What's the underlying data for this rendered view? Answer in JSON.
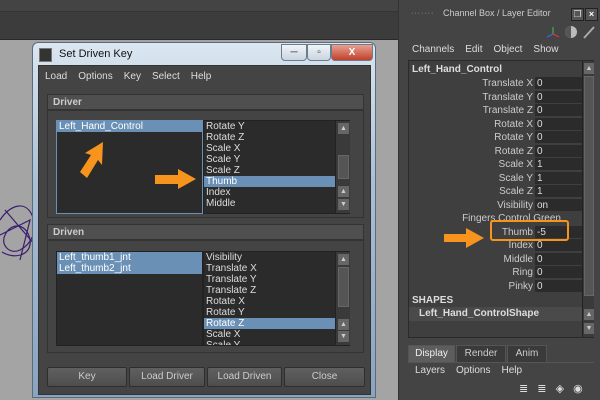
{
  "dialog": {
    "title": "Set Driven Key",
    "window_buttons": {
      "minimize": "─",
      "maximize": "▫",
      "close": "X"
    },
    "menu": [
      "Load",
      "Options",
      "Key",
      "Select",
      "Help"
    ],
    "driver": {
      "header": "Driver",
      "objects": [
        {
          "label": "Left_Hand_Control",
          "selected": true
        }
      ],
      "attributes": [
        {
          "label": "Rotate Y",
          "selected": false
        },
        {
          "label": "Rotate Z",
          "selected": false
        },
        {
          "label": "Scale X",
          "selected": false
        },
        {
          "label": "Scale Y",
          "selected": false
        },
        {
          "label": "Scale Z",
          "selected": false
        },
        {
          "label": "Thumb",
          "selected": true
        },
        {
          "label": "Index",
          "selected": false
        },
        {
          "label": "Middle",
          "selected": false
        }
      ]
    },
    "driven": {
      "header": "Driven",
      "objects": [
        {
          "label": "Left_thumb1_jnt",
          "selected": true
        },
        {
          "label": "Left_thumb2_jnt",
          "selected": true
        }
      ],
      "attributes": [
        {
          "label": "Visibility",
          "selected": false
        },
        {
          "label": "Translate X",
          "selected": false
        },
        {
          "label": "Translate Y",
          "selected": false
        },
        {
          "label": "Translate Z",
          "selected": false
        },
        {
          "label": "Rotate X",
          "selected": false
        },
        {
          "label": "Rotate Y",
          "selected": false
        },
        {
          "label": "Rotate Z",
          "selected": true
        },
        {
          "label": "Scale X",
          "selected": false
        },
        {
          "label": "Scale Y",
          "selected": false
        }
      ]
    },
    "buttons": {
      "key": "Key",
      "load_driver": "Load Driver",
      "load_driven": "Load Driven",
      "close": "Close"
    }
  },
  "channel_box": {
    "title": "Channel Box / Layer Editor",
    "menu": [
      "Channels",
      "Edit",
      "Object",
      "Show"
    ],
    "node": "Left_Hand_Control",
    "channels": [
      {
        "label": "Translate X",
        "value": "0"
      },
      {
        "label": "Translate Y",
        "value": "0"
      },
      {
        "label": "Translate Z",
        "value": "0"
      },
      {
        "label": "Rotate X",
        "value": "0"
      },
      {
        "label": "Rotate Y",
        "value": "0"
      },
      {
        "label": "Rotate Z",
        "value": "0"
      },
      {
        "label": "Scale X",
        "value": "1"
      },
      {
        "label": "Scale Y",
        "value": "1"
      },
      {
        "label": "Scale Z",
        "value": "1"
      },
      {
        "label": "Visibility",
        "value": "on"
      },
      {
        "label": "Fingers Control Green",
        "value": ""
      },
      {
        "label": "Thumb",
        "value": "-5"
      },
      {
        "label": "Index",
        "value": "0"
      },
      {
        "label": "Middle",
        "value": "0"
      },
      {
        "label": "Ring",
        "value": "0"
      },
      {
        "label": "Pinky",
        "value": "0"
      }
    ],
    "shapes_header": "SHAPES",
    "shape_node": "Left_Hand_ControlShape",
    "tabs": [
      {
        "label": "Display",
        "active": true
      },
      {
        "label": "Render",
        "active": false
      },
      {
        "label": "Anim",
        "active": false
      }
    ],
    "layer_menu": [
      "Layers",
      "Options",
      "Help"
    ]
  },
  "annotation_color": "#f7941d",
  "selection_color": "#6a90b6"
}
